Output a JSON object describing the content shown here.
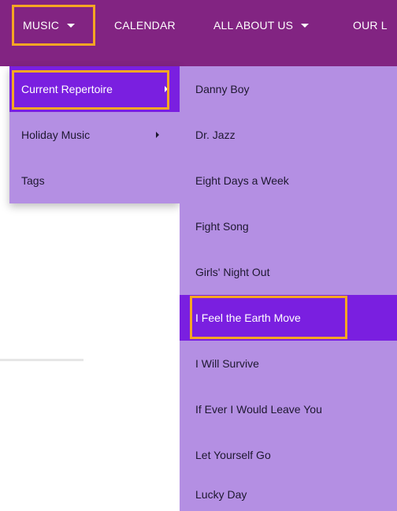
{
  "nav": {
    "items": [
      {
        "label": "MUSIC",
        "has_caret": true
      },
      {
        "label": "CALENDAR",
        "has_caret": false
      },
      {
        "label": "ALL ABOUT US",
        "has_caret": true
      },
      {
        "label": "OUR L",
        "has_caret": false
      }
    ]
  },
  "music_menu": {
    "items": [
      {
        "label": "Current Repertoire"
      },
      {
        "label": "Holiday Music"
      },
      {
        "label": "Tags"
      }
    ]
  },
  "repertoire_menu": {
    "items": [
      {
        "label": "Danny Boy"
      },
      {
        "label": "Dr. Jazz"
      },
      {
        "label": "Eight Days a Week"
      },
      {
        "label": "Fight Song"
      },
      {
        "label": "Girls' Night Out"
      },
      {
        "label": "I Feel the Earth Move"
      },
      {
        "label": "I Will Survive"
      },
      {
        "label": "If Ever I Would Leave You"
      },
      {
        "label": "Let Yourself Go"
      },
      {
        "label": "Lucky Day"
      }
    ]
  },
  "colors": {
    "navbar": "#822482",
    "menu_bg": "#b48fe3",
    "menu_active": "#7a1fe0",
    "highlight_outline": "#f5a623"
  }
}
